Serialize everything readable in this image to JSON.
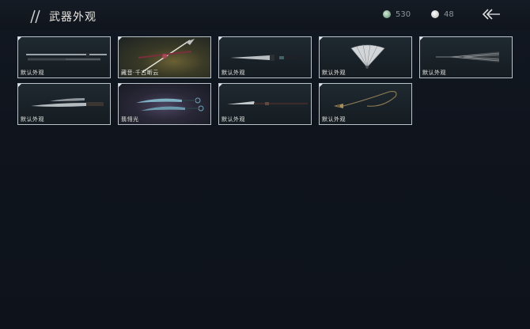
{
  "header": {
    "title": "武器外观",
    "currency_jade": "530",
    "currency_pearl": "48"
  },
  "weapons": [
    {
      "label": "默认外观",
      "icon": "twin-swords-icon"
    },
    {
      "label": "藏音·千古断云",
      "icon": "spear-icon"
    },
    {
      "label": "默认外观",
      "icon": "short-blade-icon"
    },
    {
      "label": "默认外观",
      "icon": "fan-icon"
    },
    {
      "label": "默认外观",
      "icon": "umbrella-icon"
    },
    {
      "label": "默认外观",
      "icon": "dual-sabres-icon"
    },
    {
      "label": "翡翎光",
      "icon": "dual-hooks-icon"
    },
    {
      "label": "默认外观",
      "icon": "glaive-icon"
    },
    {
      "label": "默认外观",
      "icon": "rope-dart-icon"
    }
  ],
  "colors": {
    "background": "#0f141d",
    "card_border": "#b9c3c9",
    "text": "#e6e6e2"
  }
}
